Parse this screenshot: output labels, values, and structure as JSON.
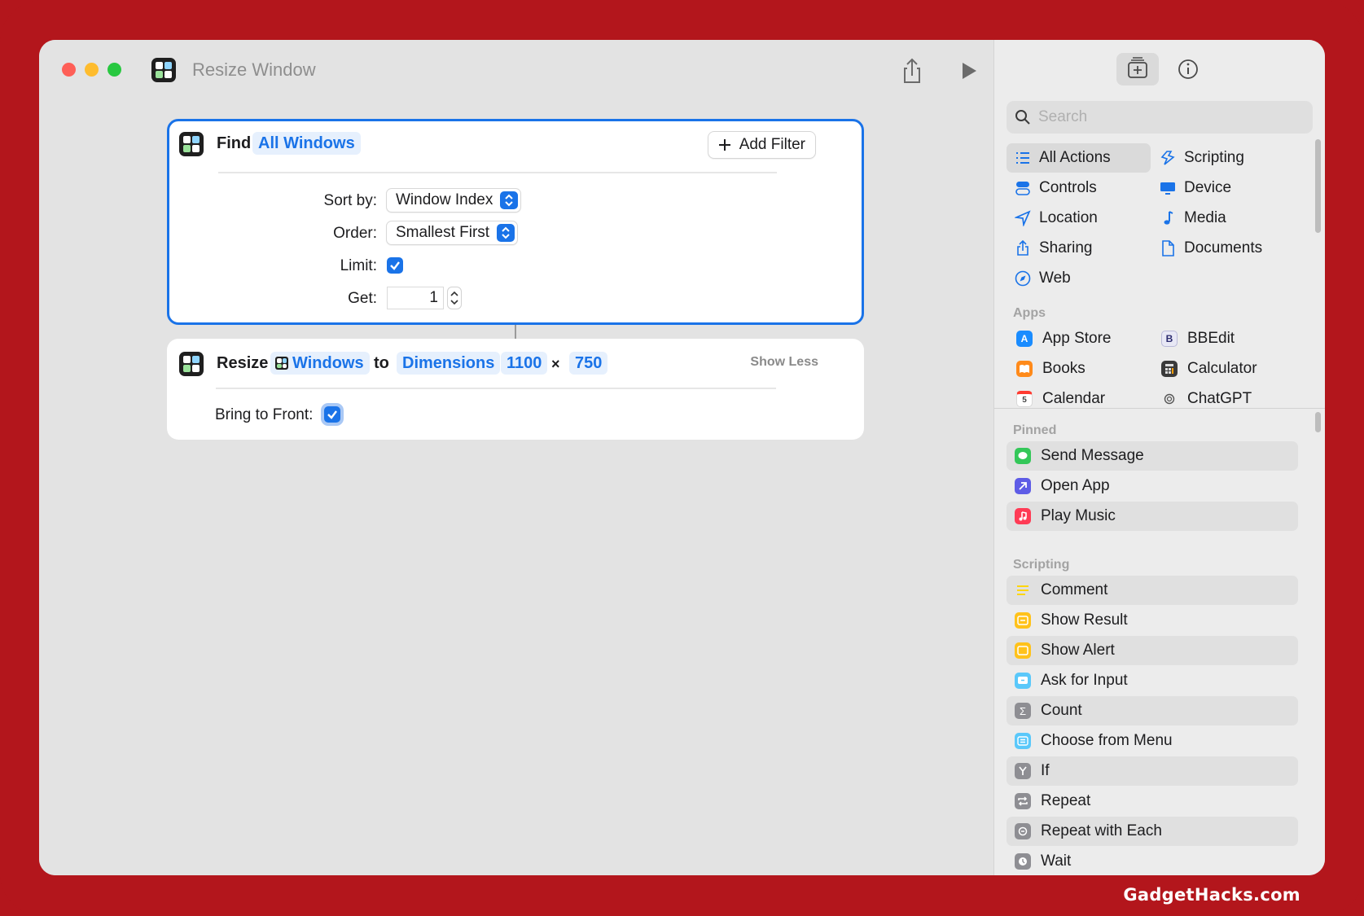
{
  "window": {
    "title": "Resize Window"
  },
  "find_action": {
    "verb": "Find",
    "subject": "All Windows",
    "add_filter_label": "Add Filter",
    "sort_by_label": "Sort by:",
    "sort_by_value": "Window Index",
    "order_label": "Order:",
    "order_value": "Smallest First",
    "limit_label": "Limit:",
    "limit_checked": true,
    "get_label": "Get:",
    "get_value": "1"
  },
  "resize_action": {
    "verb": "Resize",
    "windows_token": "Windows",
    "to_label": "to",
    "dimensions_token": "Dimensions",
    "width": "1100",
    "times": "×",
    "height": "750",
    "show_less_label": "Show Less",
    "bring_front_label": "Bring to Front:",
    "bring_front_checked": true
  },
  "sidebar": {
    "search_placeholder": "Search",
    "categories": [
      {
        "label": "All Actions",
        "icon": "list-icon",
        "selected": true
      },
      {
        "label": "Scripting",
        "icon": "scripting-icon"
      },
      {
        "label": "Controls",
        "icon": "toggle-icon"
      },
      {
        "label": "Device",
        "icon": "display-icon"
      },
      {
        "label": "Location",
        "icon": "location-arrow-icon"
      },
      {
        "label": "Media",
        "icon": "music-note-icon"
      },
      {
        "label": "Sharing",
        "icon": "share-icon"
      },
      {
        "label": "Documents",
        "icon": "document-icon"
      },
      {
        "label": "Web",
        "icon": "compass-icon"
      }
    ],
    "apps_label": "Apps",
    "apps": [
      {
        "label": "App Store",
        "color": "#1a8cff",
        "glyph": "A"
      },
      {
        "label": "BBEdit",
        "color": "#e8e8f5",
        "glyph": "B"
      },
      {
        "label": "Books",
        "color": "#ff8a1a",
        "glyph": ""
      },
      {
        "label": "Calculator",
        "color": "#3a3a3a",
        "glyph": ""
      },
      {
        "label": "Calendar",
        "color": "#ffffff",
        "glyph": "5"
      },
      {
        "label": "ChatGPT",
        "color": "#ececec",
        "glyph": ""
      }
    ],
    "pinned_label": "Pinned",
    "pinned": [
      {
        "label": "Send Message",
        "color": "#34c759"
      },
      {
        "label": "Open App",
        "color": "#5e5ce6"
      },
      {
        "label": "Play Music",
        "color": "#ff3b55"
      }
    ],
    "scripting_label": "Scripting",
    "scripting": [
      {
        "label": "Comment",
        "color": "#ffd60a"
      },
      {
        "label": "Show Result",
        "color": "#ffc21a"
      },
      {
        "label": "Show Alert",
        "color": "#ffc21a"
      },
      {
        "label": "Ask for Input",
        "color": "#5ac8fa"
      },
      {
        "label": "Count",
        "color": "#8e8e93"
      },
      {
        "label": "Choose from Menu",
        "color": "#5ac8fa"
      },
      {
        "label": "If",
        "color": "#8e8e93"
      },
      {
        "label": "Repeat",
        "color": "#8e8e93"
      },
      {
        "label": "Repeat with Each",
        "color": "#8e8e93"
      },
      {
        "label": "Wait",
        "color": "#8e8e93"
      }
    ]
  },
  "watermark": "GadgetHacks.com"
}
